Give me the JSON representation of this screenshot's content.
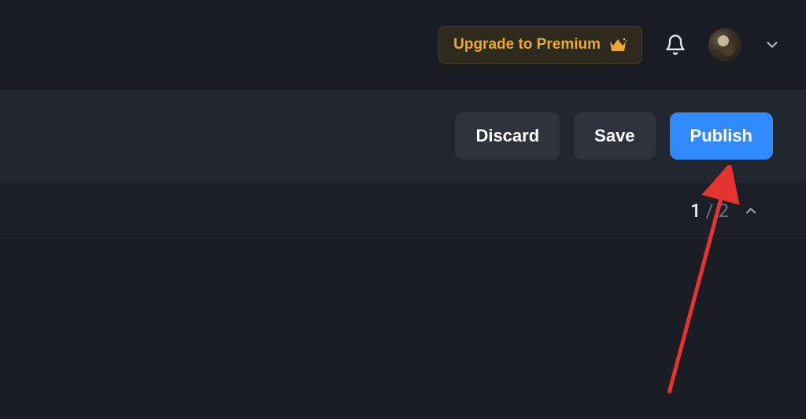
{
  "header": {
    "upgrade_label": "Upgrade to Premium"
  },
  "actions": {
    "discard_label": "Discard",
    "save_label": "Save",
    "publish_label": "Publish"
  },
  "pagination": {
    "current": "1",
    "separator": "/",
    "total": "2"
  }
}
